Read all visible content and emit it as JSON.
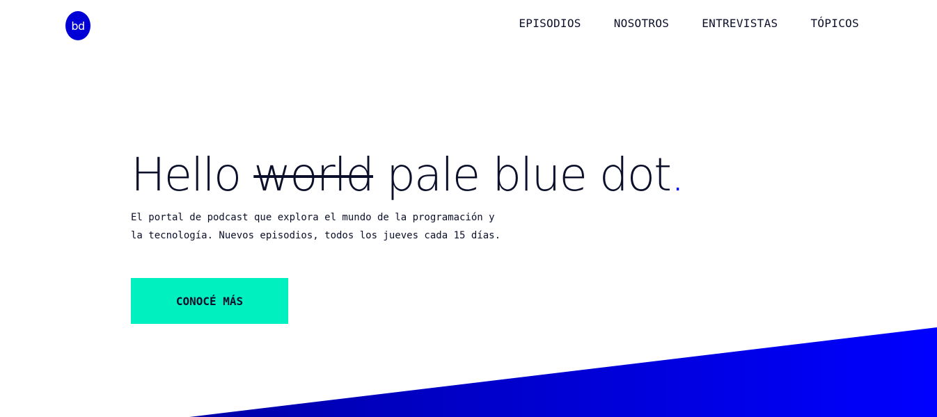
{
  "header": {
    "logo_text": "bd",
    "nav": [
      {
        "label": "EPISODIOS"
      },
      {
        "label": "NOSOTROS"
      },
      {
        "label": "ENTREVISTAS"
      },
      {
        "label": "TÓPICOS"
      }
    ]
  },
  "hero": {
    "title_hello": "Hello ",
    "title_struck": "world",
    "title_rest": " pale blue dot",
    "title_dot": ".",
    "description": "El portal de podcast que explora el mundo de la programación y la tecnología. Nuevos episodios, todos los jueves cada 15 días.",
    "cta_label": "CONOCÉ MÁS"
  },
  "colors": {
    "brand_blue": "#0000ff",
    "logo_blue": "#0000d6",
    "accent_teal": "#00f0c0",
    "text_dark": "#0b0f2a"
  }
}
